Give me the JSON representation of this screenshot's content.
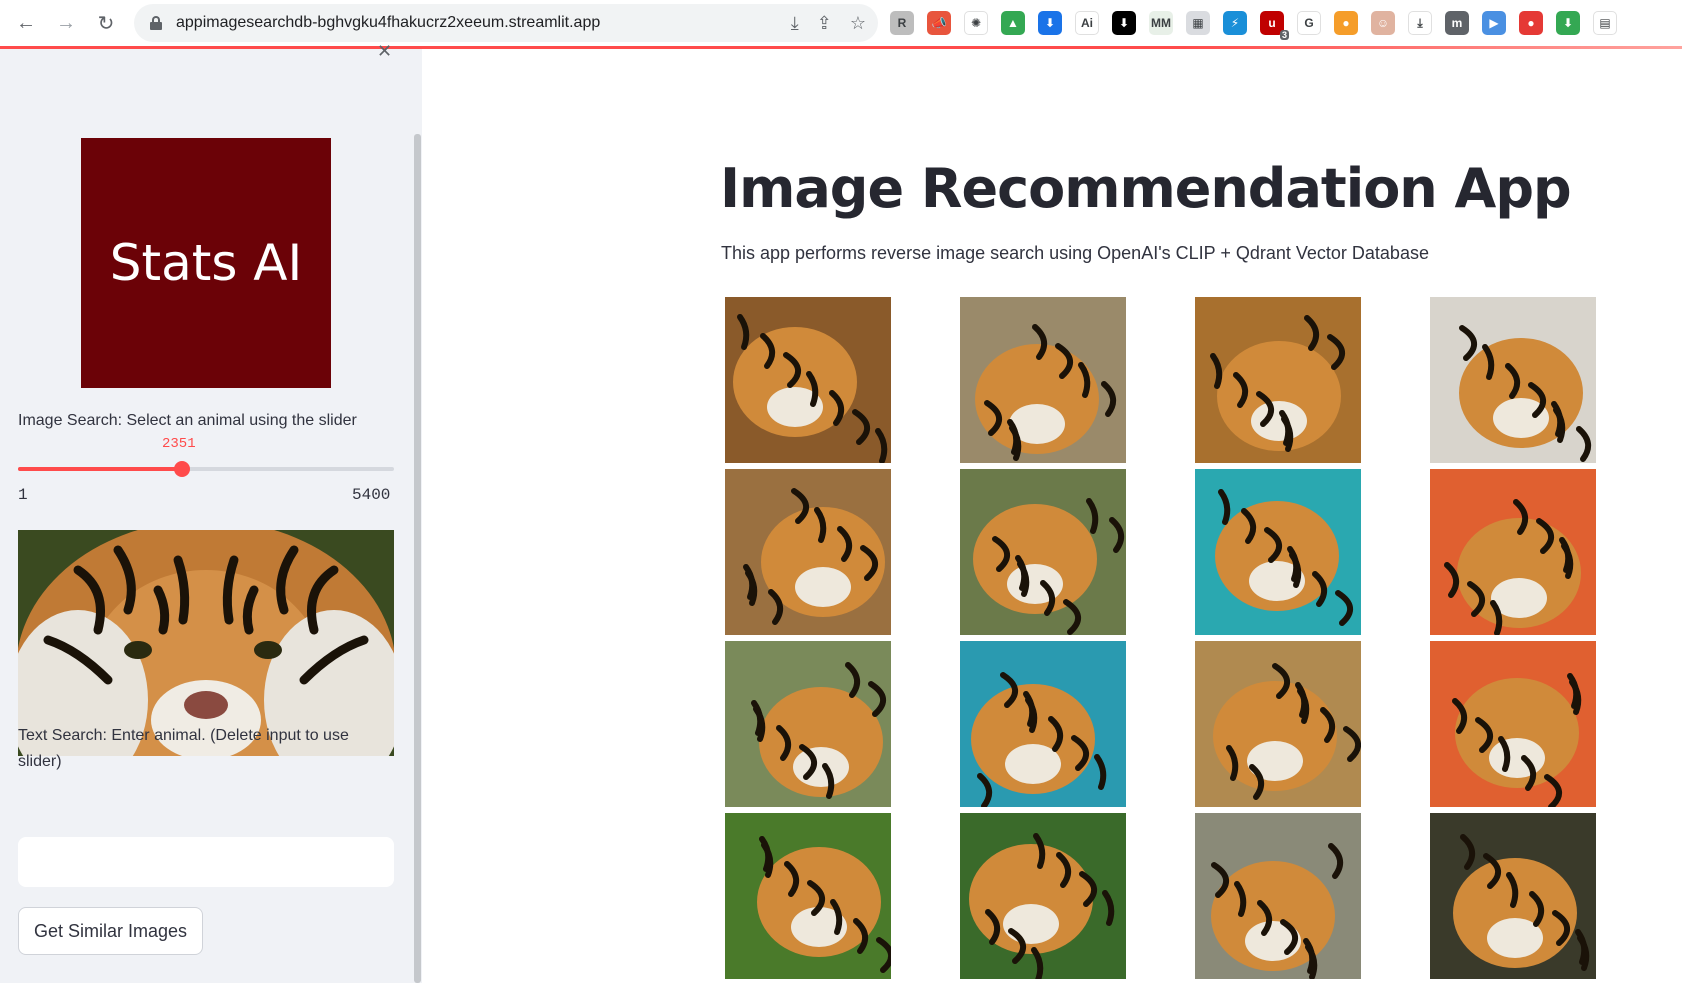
{
  "browser": {
    "url": "appimagesearchdb-bghvgku4fhakucrz2xeeum.streamlit.app",
    "extensions": [
      {
        "name": "r-ext-icon",
        "color": "#bdbdbd",
        "glyph": "R"
      },
      {
        "name": "megaphone-icon",
        "color": "#e8553d",
        "glyph": "📣"
      },
      {
        "name": "openai-icon",
        "color": "#ffffff",
        "glyph": "✺"
      },
      {
        "name": "google-drive-icon",
        "color": "#34a853",
        "glyph": "▲"
      },
      {
        "name": "save-icon",
        "color": "#1a73e8",
        "glyph": "⬇"
      },
      {
        "name": "ai-ext-icon",
        "color": "#ffffff",
        "glyph": "Ai"
      },
      {
        "name": "download-black-icon",
        "color": "#000000",
        "glyph": "⬇"
      },
      {
        "name": "mmra-icon",
        "color": "#e8f0e8",
        "glyph": "MM"
      },
      {
        "name": "tabs-icon",
        "color": "#dadce0",
        "glyph": "▦"
      },
      {
        "name": "zap-icon",
        "color": "#1a8fd8",
        "glyph": "⚡"
      },
      {
        "name": "ublock-icon",
        "color": "#c00000",
        "glyph": "u",
        "badge": "3"
      },
      {
        "name": "google-g-icon",
        "color": "#ffffff",
        "glyph": "G"
      },
      {
        "name": "bottle-icon",
        "color": "#f59d2a",
        "glyph": "●"
      },
      {
        "name": "face-icon",
        "color": "#e0b3a0",
        "glyph": "☺"
      },
      {
        "name": "download-icon",
        "color": "#ffffff",
        "glyph": "⤓"
      },
      {
        "name": "m-ext-icon",
        "color": "#5f6368",
        "glyph": "m"
      },
      {
        "name": "play-icon",
        "color": "#4a90e2",
        "glyph": "▶"
      },
      {
        "name": "record-icon",
        "color": "#e53935",
        "glyph": "●"
      },
      {
        "name": "green-download-icon",
        "color": "#34a853",
        "glyph": "⬇"
      },
      {
        "name": "reader-icon",
        "color": "#ffffff",
        "glyph": "▤"
      }
    ]
  },
  "sidebar": {
    "logo_text": "Stats AI",
    "image_search_label": "Image Search: Select an animal using the slider",
    "slider": {
      "value": "2351",
      "min": "1",
      "max": "5400",
      "fraction": 0.4352
    },
    "text_search_label_line1": "Text Search: Enter animal. (Delete input to use",
    "text_search_label_line2": "slider)",
    "text_input_value": "",
    "button_label": "Get Similar Images"
  },
  "main": {
    "title": "Image Recommendation App",
    "subtitle": "This app performs reverse image search using OpenAI's CLIP + Qdrant Vector Database",
    "results": [
      {
        "name": "result-image-tiger-face",
        "bg": "#8a5a2a"
      },
      {
        "name": "result-image-tiger-standing",
        "bg": "#9a8a6a"
      },
      {
        "name": "result-image-tiger-roaring",
        "bg": "#a8702e"
      },
      {
        "name": "result-image-tiger-closeup-roar",
        "bg": "#d8d4cc"
      },
      {
        "name": "result-image-tiger-head-down",
        "bg": "#9a7040"
      },
      {
        "name": "result-image-tiger-walking",
        "bg": "#6b7a4a"
      },
      {
        "name": "result-image-tiger-teal-roar",
        "bg": "#2aa8b0"
      },
      {
        "name": "result-image-tiger-orange-roar",
        "bg": "#e06030"
      },
      {
        "name": "result-image-tiger-red-fence",
        "bg": "#7a8a5a"
      },
      {
        "name": "result-image-tiger-water",
        "bg": "#2a9ab0"
      },
      {
        "name": "result-image-tiger-prowl",
        "bg": "#b08a50"
      },
      {
        "name": "result-image-tiger-orange-roar-2",
        "bg": "#e06030"
      },
      {
        "name": "result-image-tiger-portrait",
        "bg": "#4a7a2a"
      },
      {
        "name": "result-image-white-tiger",
        "bg": "#3a6a2a"
      },
      {
        "name": "result-image-tiger-road",
        "bg": "#8a8a78"
      },
      {
        "name": "result-image-tiger-leaping",
        "bg": "#3a3a2a"
      }
    ]
  }
}
